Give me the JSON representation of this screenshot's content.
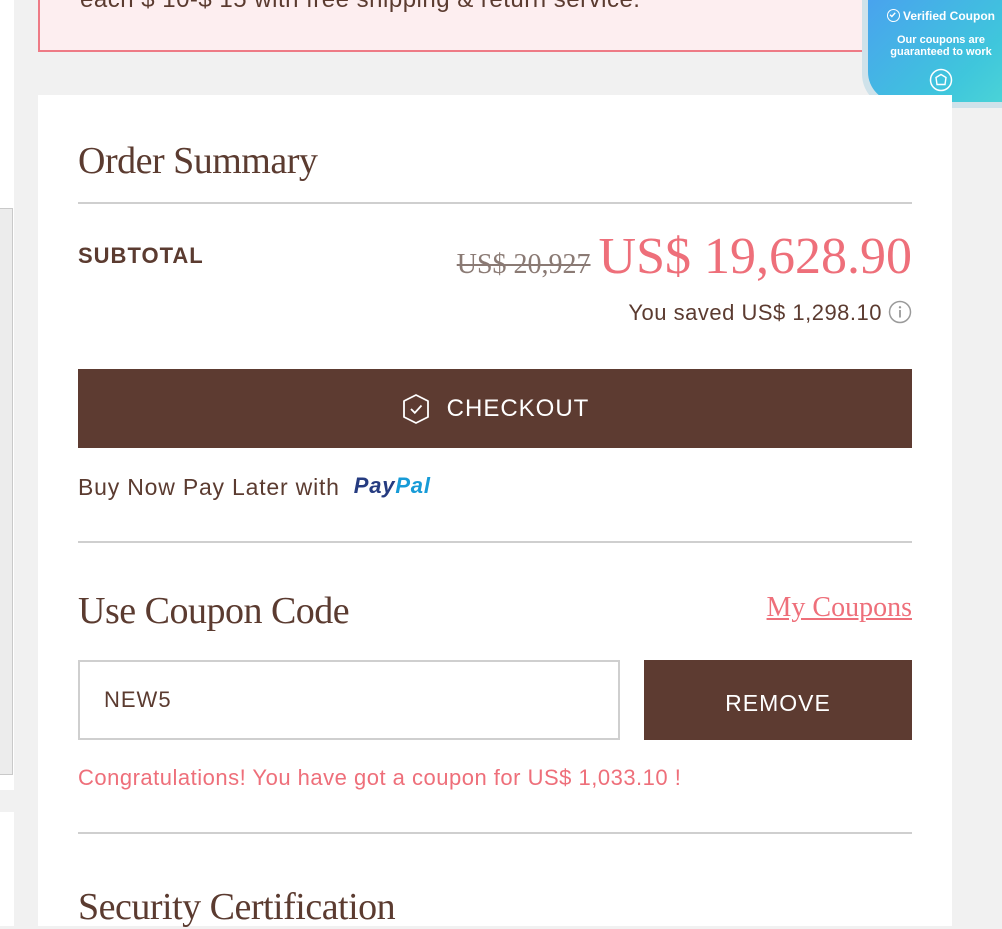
{
  "notice": {
    "text": "each $ 10-$ 15 with free shipping & return service."
  },
  "badge": {
    "title": "Verified Coupon",
    "subtitle_line1": "Our coupons are",
    "subtitle_line2": "guaranteed to work"
  },
  "order_summary": {
    "title": "Order Summary",
    "subtotal_label": "SUBTOTAL",
    "original_price": "US$ 20,927",
    "final_price": "US$ 19,628.90",
    "saved_text": "You saved US$ 1,298.10",
    "checkout_label": "CHECKOUT",
    "bnpl_text": "Buy Now Pay Later with",
    "paypal_part1": "Pay",
    "paypal_part2": "Pal"
  },
  "coupon": {
    "title": "Use Coupon Code",
    "my_coupons_link": "My Coupons",
    "code_value": "NEW5",
    "remove_label": "REMOVE",
    "success_message": "Congratulations! You have got a coupon for US$ 1,033.10 !"
  },
  "security": {
    "title": "Security Certification"
  },
  "colors": {
    "brown": "#5d3b31",
    "accent_pink": "#ee6f7a",
    "notice_border": "#ee7b86"
  }
}
